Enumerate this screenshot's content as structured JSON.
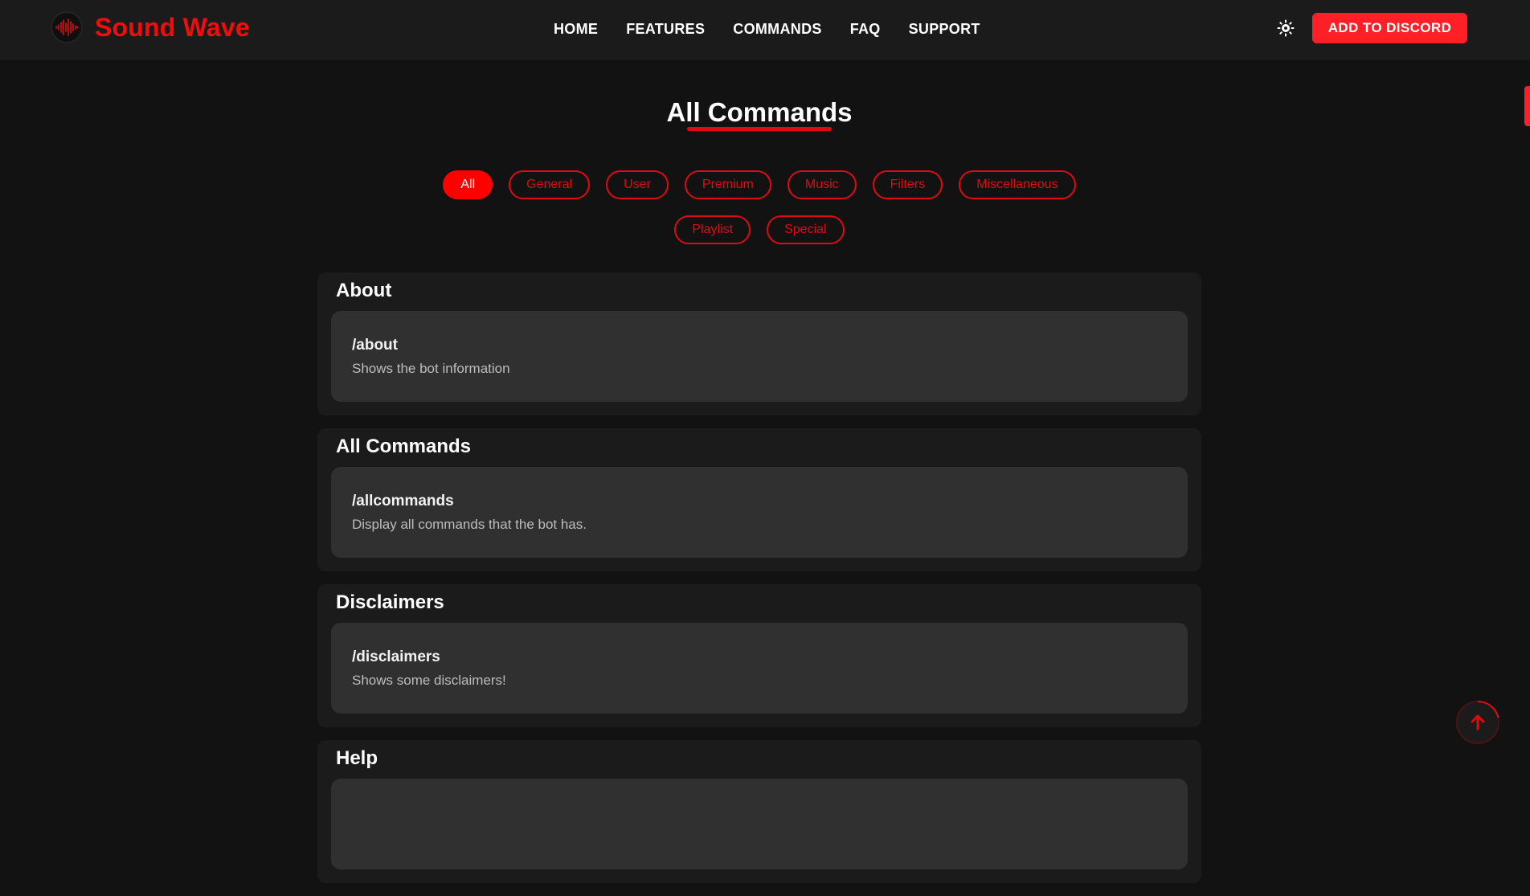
{
  "navbar": {
    "brand": "Sound Wave",
    "links": [
      {
        "label": "HOME"
      },
      {
        "label": "FEATURES"
      },
      {
        "label": "COMMANDS"
      },
      {
        "label": "FAQ"
      },
      {
        "label": "SUPPORT"
      }
    ],
    "theme_toggle_icon": "sun-icon",
    "cta_label": "ADD TO DISCORD"
  },
  "page": {
    "title": "All Commands"
  },
  "filters": [
    {
      "label": "All",
      "active": true
    },
    {
      "label": "General",
      "active": false
    },
    {
      "label": "User",
      "active": false
    },
    {
      "label": "Premium",
      "active": false
    },
    {
      "label": "Music",
      "active": false
    },
    {
      "label": "Filters",
      "active": false
    },
    {
      "label": "Miscellaneous",
      "active": false
    },
    {
      "label": "Playlist",
      "active": false
    },
    {
      "label": "Special",
      "active": false
    }
  ],
  "sections": [
    {
      "title": "About",
      "command": "/about",
      "description": "Shows the bot information"
    },
    {
      "title": "All Commands",
      "command": "/allcommands",
      "description": "Display all commands that the bot has."
    },
    {
      "title": "Disclaimers",
      "command": "/disclaimers",
      "description": "Shows some disclaimers!"
    },
    {
      "title": "Help",
      "command": "",
      "description": ""
    }
  ],
  "scroll_top_icon": "arrow-up-icon",
  "colors": {
    "accent": "#ff1f26",
    "brand_text": "#f20d0d",
    "background": "#121212",
    "navbar": "#1b1b1b",
    "card": "#303030"
  }
}
